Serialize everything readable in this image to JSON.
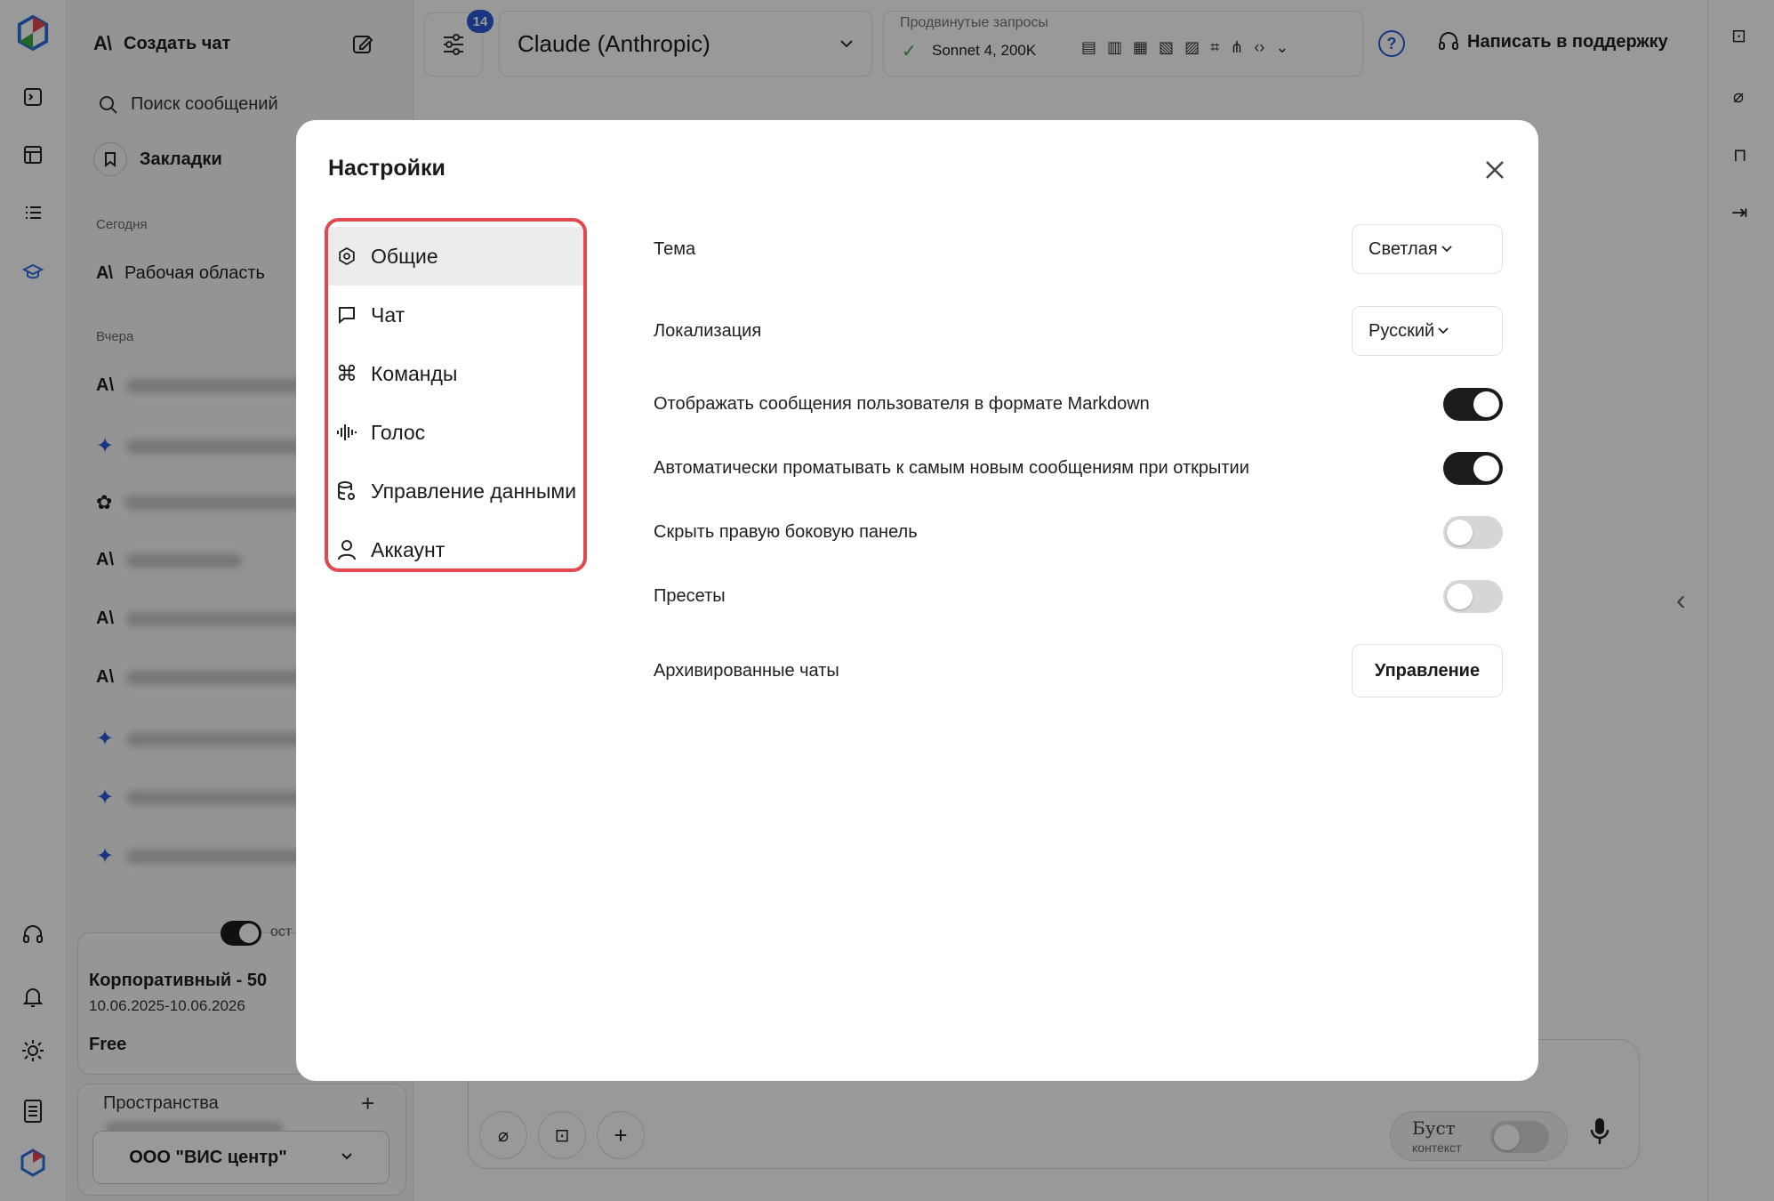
{
  "sidebar": {
    "create_chat": "Создать чат",
    "search_placeholder": "Поиск сообщений",
    "bookmarks": "Закладки",
    "section_today": "Сегодня",
    "workspace": "Рабочая область",
    "section_yesterday": "Вчера",
    "toggle_partial_label": "ост",
    "plan_name": "Корпоративный - 50",
    "plan_dates": "10.06.2025-10.06.2026",
    "plan_tier": "Free",
    "spaces_title": "Пространства",
    "spaces_add": "+",
    "org_name": "ООО \"ВИС центр\""
  },
  "header": {
    "filter_badge": "14",
    "model_name": "Claude (Anthropic)",
    "advanced_title": "Продвинутые запросы",
    "advanced_value": "Sonnet 4, 200K",
    "support_label": "Написать в поддержку"
  },
  "composer": {
    "boost_label": "Буст",
    "boost_sub": "контекст"
  },
  "modal": {
    "title": "Настройки",
    "menu": [
      {
        "label": "Общие",
        "icon": "gear-icon",
        "active": true
      },
      {
        "label": "Чат",
        "icon": "chat-bubble-icon",
        "active": false
      },
      {
        "label": "Команды",
        "icon": "command-icon",
        "active": false
      },
      {
        "label": "Голос",
        "icon": "voice-wave-icon",
        "active": false
      },
      {
        "label": "Управление данными",
        "icon": "database-icon",
        "active": false
      },
      {
        "label": "Аккаунт",
        "icon": "user-icon",
        "active": false
      }
    ],
    "settings": {
      "theme_label": "Тема",
      "theme_value": "Светлая",
      "locale_label": "Локализация",
      "locale_value": "Русский",
      "markdown_label": "Отображать сообщения пользователя в формате Markdown",
      "markdown_on": true,
      "autoscroll_label": "Автоматически проматывать к самым новым сообщениям при открытии",
      "autoscroll_on": true,
      "hide_panel_label": "Скрыть правую боковую панель",
      "hide_panel_on": false,
      "presets_label": "Пресеты",
      "presets_on": false,
      "archived_label": "Архивированные чаты",
      "archived_button": "Управление"
    }
  },
  "colors": {
    "highlight_border": "#e5474f",
    "toggle_on": "#1c1c1c",
    "toggle_off": "#d6d6d6",
    "accent_blue": "#2a5ad8",
    "check_green": "#3aa845"
  }
}
